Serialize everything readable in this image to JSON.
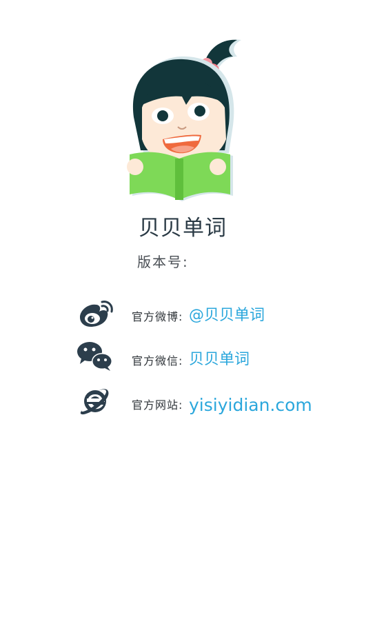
{
  "app": {
    "name": "贝贝单词",
    "version_label": "版本号:"
  },
  "contacts": [
    {
      "icon": "weibo-icon",
      "label": "官方微博:",
      "value": "@贝贝单词"
    },
    {
      "icon": "wechat-icon",
      "label": "官方微信:",
      "value": "贝贝单词"
    },
    {
      "icon": "ie-browser-icon",
      "label": "官方网站:",
      "value": "yisiyidian.com"
    }
  ],
  "colors": {
    "accent_link": "#2ba7dc",
    "icon_dark": "#2c3e4c",
    "book_green": "#7ed957",
    "hair_dark": "#12363a"
  }
}
